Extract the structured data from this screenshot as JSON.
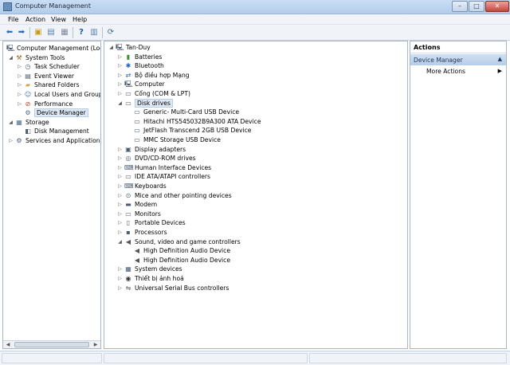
{
  "window": {
    "title": "Computer Management",
    "controls": [
      "–",
      "□",
      "✕"
    ]
  },
  "menu": [
    "File",
    "Action",
    "View",
    "Help"
  ],
  "left_tree": [
    {
      "label": "Computer Management (Local",
      "icon": "computer-icon",
      "level": 0,
      "exp": ""
    },
    {
      "label": "System Tools",
      "icon": "tools-icon",
      "level": 1,
      "exp": "◢"
    },
    {
      "label": "Task Scheduler",
      "icon": "clock-icon",
      "level": 2,
      "exp": "▷"
    },
    {
      "label": "Event Viewer",
      "icon": "event-icon",
      "level": 2,
      "exp": "▷"
    },
    {
      "label": "Shared Folders",
      "icon": "folder-icon",
      "level": 2,
      "exp": "▷"
    },
    {
      "label": "Local Users and Groups",
      "icon": "users-icon",
      "level": 2,
      "exp": "▷"
    },
    {
      "label": "Performance",
      "icon": "performance-icon",
      "level": 2,
      "exp": "▷"
    },
    {
      "label": "Device Manager",
      "icon": "device-manager-icon",
      "level": 2,
      "exp": "",
      "selected": true
    },
    {
      "label": "Storage",
      "icon": "storage-icon",
      "level": 1,
      "exp": "◢"
    },
    {
      "label": "Disk Management",
      "icon": "disk-icon",
      "level": 2,
      "exp": ""
    },
    {
      "label": "Services and Applications",
      "icon": "services-icon",
      "level": 1,
      "exp": "▷"
    }
  ],
  "device_tree": [
    {
      "label": "Tan-Duy",
      "icon": "computer-icon",
      "level": 0,
      "exp": "◢"
    },
    {
      "label": "Batteries",
      "icon": "battery-icon",
      "level": 1,
      "exp": "▷"
    },
    {
      "label": "Bluetooth",
      "icon": "bluetooth-icon",
      "level": 1,
      "exp": "▷"
    },
    {
      "label": "Bộ điều hợp Mạng",
      "icon": "network-icon",
      "level": 1,
      "exp": "▷"
    },
    {
      "label": "Computer",
      "icon": "computer-icon",
      "level": 1,
      "exp": "▷"
    },
    {
      "label": "Cổng (COM & LPT)",
      "icon": "port-icon",
      "level": 1,
      "exp": "▷"
    },
    {
      "label": "Disk drives",
      "icon": "disk-drive-icon",
      "level": 1,
      "exp": "◢",
      "selected": true
    },
    {
      "label": "Generic- Multi-Card USB Device",
      "icon": "disk-drive-icon",
      "level": 2,
      "exp": ""
    },
    {
      "label": "Hitachi HTS545032B9A300 ATA Device",
      "icon": "disk-drive-icon",
      "level": 2,
      "exp": ""
    },
    {
      "label": "JetFlash Transcend 2GB USB Device",
      "icon": "disk-drive-icon",
      "level": 2,
      "exp": ""
    },
    {
      "label": "MMC Storage USB Device",
      "icon": "disk-drive-icon",
      "level": 2,
      "exp": ""
    },
    {
      "label": "Display adapters",
      "icon": "display-icon",
      "level": 1,
      "exp": "▷"
    },
    {
      "label": "DVD/CD-ROM drives",
      "icon": "dvd-icon",
      "level": 1,
      "exp": "▷"
    },
    {
      "label": "Human Interface Devices",
      "icon": "hid-icon",
      "level": 1,
      "exp": "▷"
    },
    {
      "label": "IDE ATA/ATAPI controllers",
      "icon": "ide-icon",
      "level": 1,
      "exp": "▷"
    },
    {
      "label": "Keyboards",
      "icon": "keyboard-icon",
      "level": 1,
      "exp": "▷"
    },
    {
      "label": "Mice and other pointing devices",
      "icon": "mouse-icon",
      "level": 1,
      "exp": "▷"
    },
    {
      "label": "Modem",
      "icon": "modem-icon",
      "level": 1,
      "exp": "▷"
    },
    {
      "label": "Monitors",
      "icon": "monitor-icon",
      "level": 1,
      "exp": "▷"
    },
    {
      "label": "Portable Devices",
      "icon": "portable-icon",
      "level": 1,
      "exp": "▷"
    },
    {
      "label": "Processors",
      "icon": "processor-icon",
      "level": 1,
      "exp": "▷"
    },
    {
      "label": "Sound, video and game controllers",
      "icon": "sound-icon",
      "level": 1,
      "exp": "◢"
    },
    {
      "label": "High Definition Audio Device",
      "icon": "sound-icon",
      "level": 2,
      "exp": ""
    },
    {
      "label": "High Definition Audio Device",
      "icon": "sound-icon",
      "level": 2,
      "exp": ""
    },
    {
      "label": "System devices",
      "icon": "system-icon",
      "level": 1,
      "exp": "▷"
    },
    {
      "label": "Thiết bị ảnh hoá",
      "icon": "camera-icon",
      "level": 1,
      "exp": "▷"
    },
    {
      "label": "Universal Serial Bus controllers",
      "icon": "usb-icon",
      "level": 1,
      "exp": "▷"
    }
  ],
  "actions": {
    "header": "Actions",
    "section": "Device Manager",
    "items": [
      "More Actions"
    ]
  },
  "colors": {
    "selection": "#dfe9f5",
    "titlebar": "#c9def5",
    "close": "#c4493a"
  }
}
